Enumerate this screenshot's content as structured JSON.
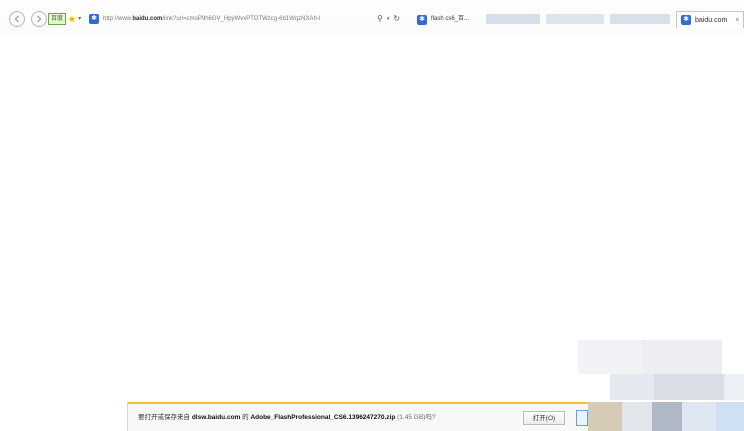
{
  "browser": {
    "search_provider_label": "百度",
    "address_url_prefix": "http://www.",
    "address_url_domain": "baidu.com",
    "address_url_path": "/link?url=cmoP9h6GV_HpyWvxPTOTWzcg-6b1WqzNXAh-l",
    "tabs": [
      {
        "title": "flash cs6_百..."
      },
      {
        "title": "baidu.com"
      }
    ]
  },
  "download_bar": {
    "message_prefix": "要打开或保存来自",
    "source_domain": "dlsw.baidu.com",
    "message_mid": "的",
    "file_name": "Adobe_FlashProfessional_CS6.1396247270.zip",
    "file_size": "(1.45 GB)吗?",
    "open_button_label": "打开(O)"
  }
}
